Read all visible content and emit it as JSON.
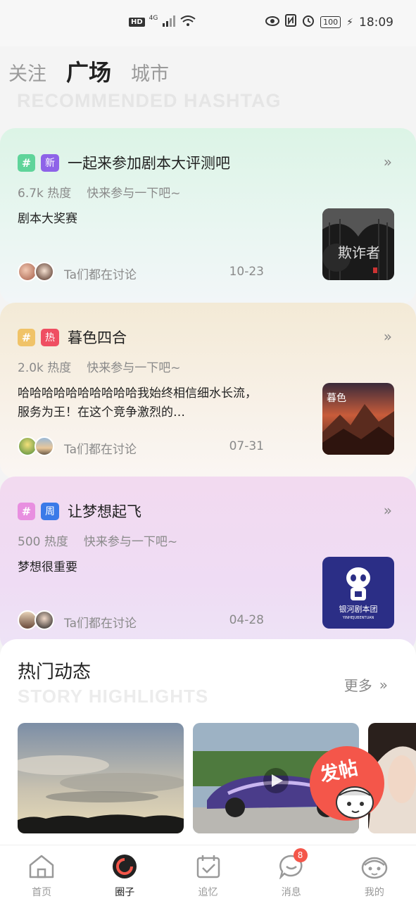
{
  "status": {
    "network": "4G",
    "hd": "HD",
    "battery": "100",
    "time": "18:09"
  },
  "top_tabs": [
    "关注",
    "广场",
    "城市"
  ],
  "hashtag_section_title": "RECOMMENDED HASHTAG",
  "cards": [
    {
      "hash": "#",
      "hash_color": "#5fd49a",
      "badge": "新",
      "badge_color": "#8e63e8",
      "title": "一起来参加剧本大评测吧",
      "heat": "6.7k 热度",
      "slogan": "快来参与一下吧~",
      "desc": "剧本大奖赛",
      "foot": "Ta们都在讨论",
      "date": "10-23",
      "thumb_text": "欺诈者"
    },
    {
      "hash": "#",
      "hash_color": "#f0c368",
      "badge": "热",
      "badge_color": "#ef4f62",
      "title": "暮色四合",
      "heat": "2.0k 热度",
      "slogan": "快来参与一下吧~",
      "desc": "哈哈哈哈哈哈哈哈哈哈我始终相信细水长流，服务为王！在这个竞争激烈的…",
      "foot": "Ta们都在讨论",
      "date": "07-31",
      "thumb_text": "暮色"
    },
    {
      "hash": "#",
      "hash_color": "#e88fe0",
      "badge": "周",
      "badge_color": "#3a7ae8",
      "title": "让梦想起飞",
      "heat": "500 热度",
      "slogan": "快来参与一下吧~",
      "desc": "梦想很重要",
      "foot": "Ta们都在讨论",
      "date": "04-28",
      "thumb_text": "银河剧本团",
      "thumb_sub": "YINHEJUBENTUAN"
    }
  ],
  "highlights": {
    "title": "热门动态",
    "subtitle": "STORY HIGHLIGHTS",
    "more": "更多"
  },
  "fab": {
    "label": "发帖"
  },
  "bottom_nav": [
    {
      "label": "首页"
    },
    {
      "label": "圈子"
    },
    {
      "label": "追忆"
    },
    {
      "label": "消息",
      "badge": "8"
    },
    {
      "label": "我的"
    }
  ]
}
